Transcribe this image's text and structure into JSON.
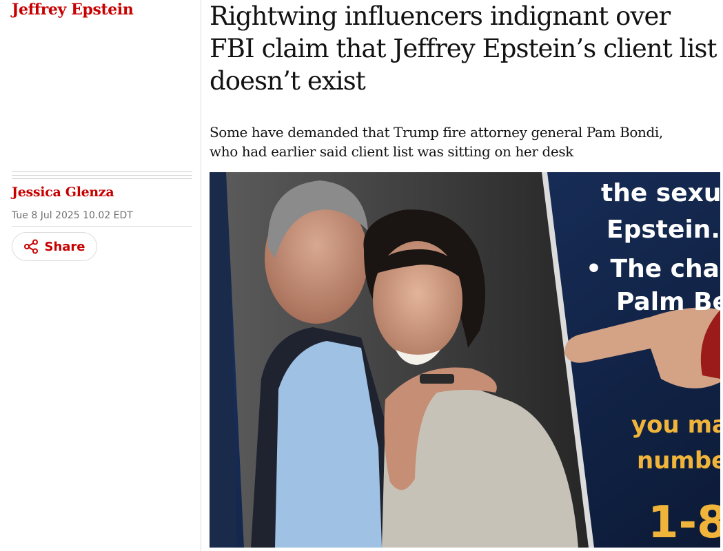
{
  "section_tag": "Jeffrey Epstein",
  "byline": {
    "author": "Jessica Glenza",
    "date": "Tue 8 Jul 2025 10.02 EDT"
  },
  "share": {
    "label": "Share",
    "icon": "share-icon"
  },
  "article": {
    "headline": "Rightwing influencers indignant over FBI claim that Jeffrey Epstein’s client list doesn’t exist",
    "standfirst": "Some have demanded that Trump fire attorney general Pam Bondi, who had earlier said client list was sitting on her desk"
  },
  "photo": {
    "poster_lines": [
      "the sexual",
      "Epstein.",
      "• The charg",
      "Palm Be",
      "you ma",
      "numbe",
      "1-8"
    ]
  },
  "colors": {
    "accent": "#c70000",
    "text": "#121212",
    "muted": "#707070",
    "poster_blue": "#12264d",
    "poster_gold": "#f1b43a"
  }
}
